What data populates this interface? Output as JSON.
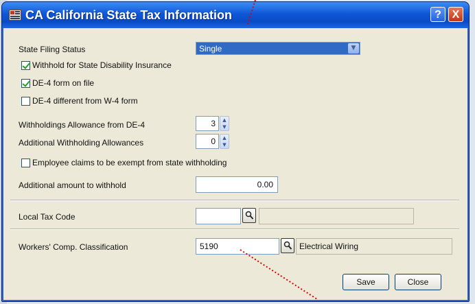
{
  "window": {
    "title": "CA California State Tax Information",
    "help_glyph": "?",
    "close_glyph": "X",
    "title_color": "#0a4bc4"
  },
  "form": {
    "filing_status_label": "State Filing Status",
    "filing_status_value": "Single",
    "sdi_label": "Withhold for State Disability Insurance",
    "sdi_checked": true,
    "de4_on_file_label": "DE-4 form on file",
    "de4_on_file_checked": true,
    "de4_diff_label": "DE-4 different from W-4 form",
    "de4_diff_checked": false,
    "allowances_label": "Withholdings Allowance from DE-4",
    "allowances_value": "3",
    "additional_allowances_label": "Additional Withholding Allowances",
    "additional_allowances_value": "0",
    "exempt_label": "Employee claims to be exempt from state withholding",
    "exempt_checked": false,
    "additional_amount_label": "Additional amount to withhold",
    "additional_amount_value": "0.00"
  },
  "local": {
    "label": "Local Tax Code",
    "code_value": "",
    "description": ""
  },
  "workers_comp": {
    "label": "Workers' Comp. Classification",
    "code_value": "5190",
    "description": "Electrical Wiring"
  },
  "buttons": {
    "save": "Save",
    "close": "Close"
  },
  "icons": {
    "app": "form-icon",
    "lookup": "magnifier-icon",
    "spinner": "spinner-arrows-icon",
    "dropdown": "chevron-down-icon"
  },
  "annotation_color": "#e00000"
}
